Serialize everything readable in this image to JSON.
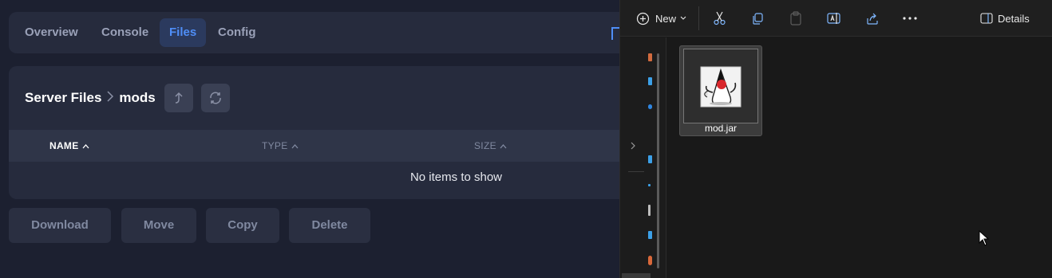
{
  "tabs": [
    {
      "label": "Overview"
    },
    {
      "label": "Console"
    },
    {
      "label": "Files",
      "active": true
    },
    {
      "label": "Config"
    }
  ],
  "breadcrumb": {
    "root": "Server Files",
    "current": "mods"
  },
  "table": {
    "columns": [
      {
        "label": "NAME",
        "sort": "asc"
      },
      {
        "label": "TYPE",
        "sort": "asc"
      },
      {
        "label": "SIZE",
        "sort": "asc"
      }
    ],
    "empty_text": "No items to show"
  },
  "actions": [
    "Download",
    "Move",
    "Copy",
    "Delete"
  ],
  "explorer": {
    "toolbar": {
      "new_label": "New",
      "details_label": "Details"
    },
    "file": {
      "name": "mod.jar",
      "icon": "java-duke-icon"
    }
  },
  "colors": {
    "accent": "#4f8ef7",
    "panel": "#262b3d",
    "explorer_bg": "#191919"
  }
}
